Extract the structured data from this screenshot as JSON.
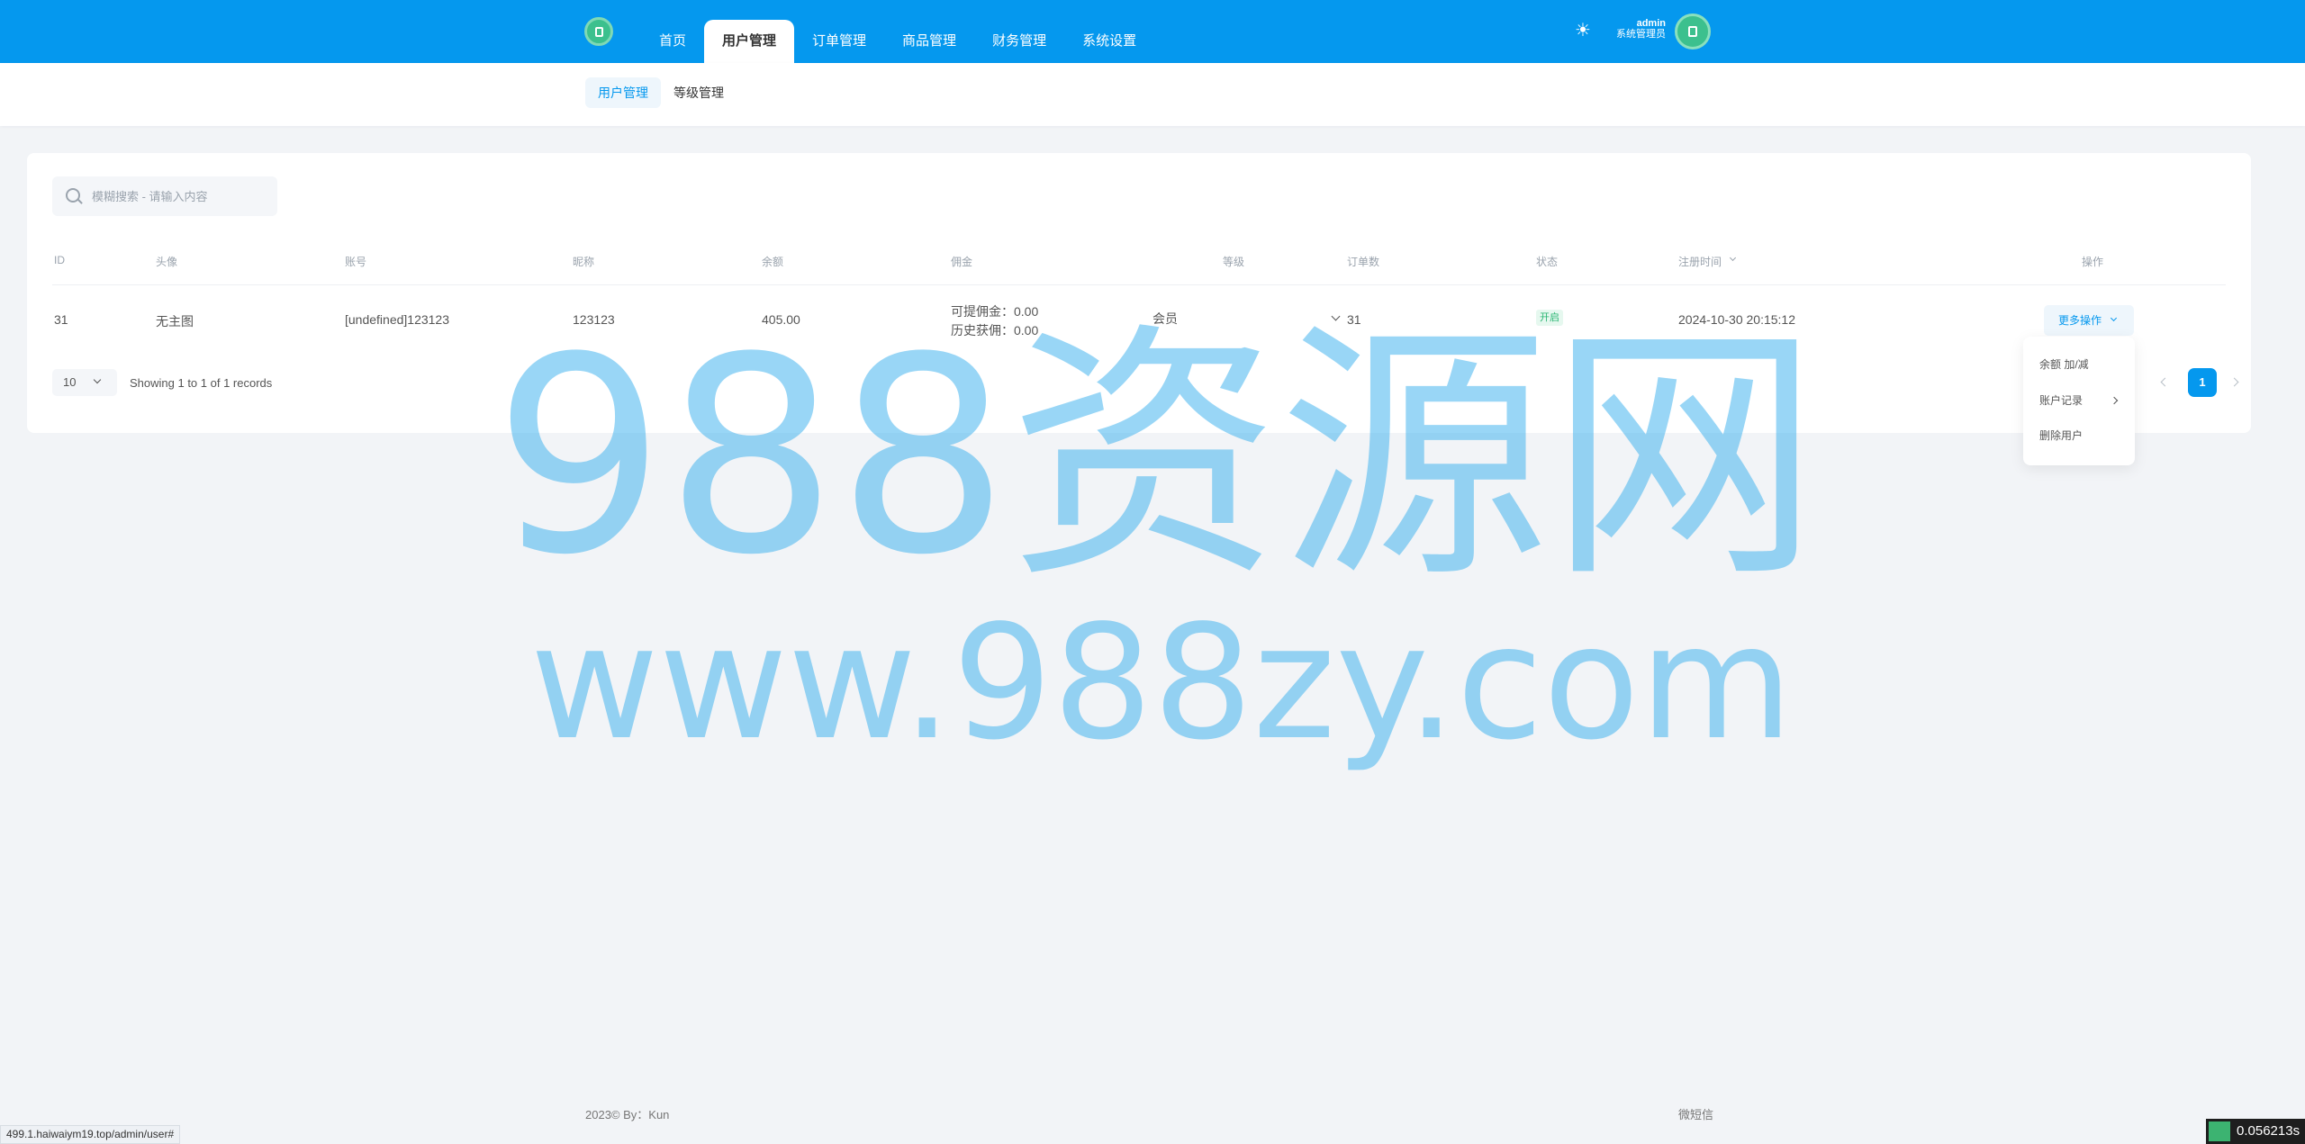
{
  "nav": {
    "items": [
      {
        "label": "首页"
      },
      {
        "label": "用户管理"
      },
      {
        "label": "订单管理"
      },
      {
        "label": "商品管理"
      },
      {
        "label": "财务管理"
      },
      {
        "label": "系统设置"
      }
    ],
    "active": "用户管理"
  },
  "user": {
    "name": "admin",
    "role": "系统管理员"
  },
  "subnav": {
    "items": [
      {
        "label": "用户管理"
      },
      {
        "label": "等级管理"
      }
    ]
  },
  "search": {
    "placeholder": "模糊搜索 - 请输入内容"
  },
  "table": {
    "headers": [
      "ID",
      "头像",
      "账号",
      "昵称",
      "余额",
      "佣金",
      "等级",
      "订单数",
      "状态",
      "注册时间",
      "操作"
    ],
    "rows": [
      {
        "id": "31",
        "avatar_alt": "无主图",
        "account": "[undefined]123123",
        "nickname": "123123",
        "balance": "405.00",
        "commission_available": "可提佣金：0.00",
        "commission_history": "历史获佣：0.00",
        "level": "会员",
        "orders": "31",
        "status": "开启",
        "registered": "2024-10-30 20:15:12",
        "action": "更多操作"
      }
    ]
  },
  "dropdown": {
    "items": [
      "余额 加/减",
      "账户记录",
      "删除用户"
    ]
  },
  "pagination": {
    "page_size": "10",
    "records_text": "Showing 1 to 1 of 1 records",
    "current": "1"
  },
  "watermark": {
    "line1": "988资源网",
    "line2": "www.988zy.com"
  },
  "footer": {
    "left": "2023© By：Kun",
    "right": "微短信"
  },
  "status_bar": {
    "url": "499.1.haiwaiym19.top/admin/user#"
  },
  "timer": {
    "value": "0.056213s"
  },
  "colors": {
    "primary": "#0598ee",
    "success": "#2bb673",
    "background": "#f2f4f7"
  }
}
